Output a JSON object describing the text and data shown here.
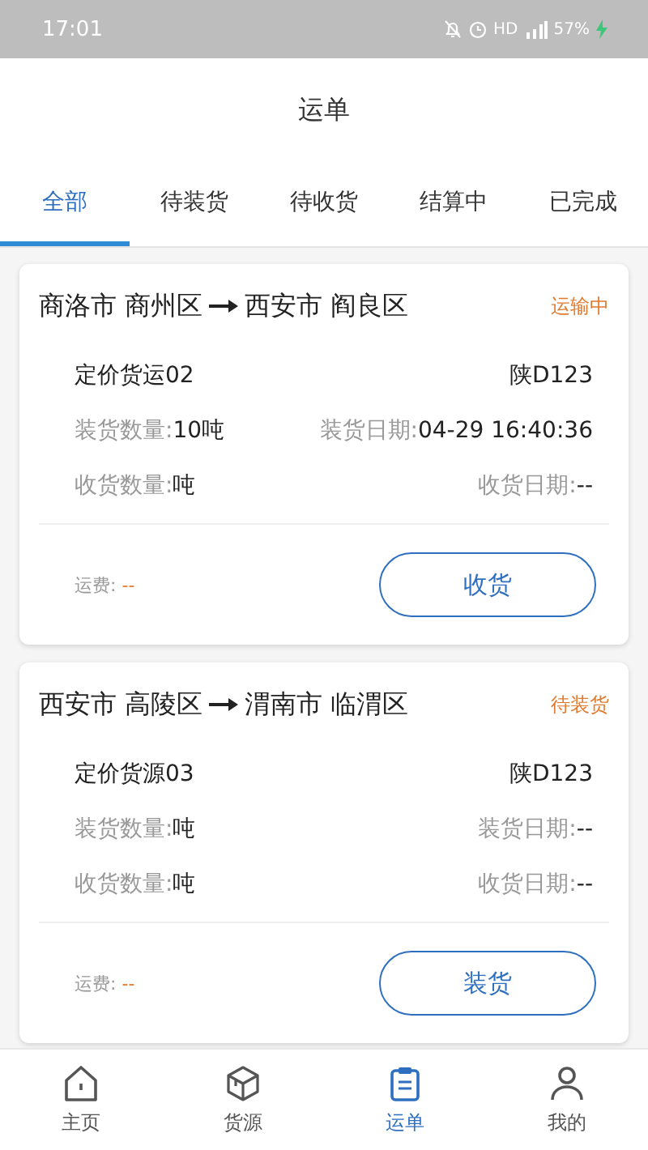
{
  "status_bar": {
    "time": "17:01",
    "network": "HD",
    "battery": "57%"
  },
  "title": "运单",
  "tabs": [
    {
      "label": "全部",
      "selected": true
    },
    {
      "label": "待装货",
      "selected": false
    },
    {
      "label": "待收货",
      "selected": false
    },
    {
      "label": "结算中",
      "selected": false
    },
    {
      "label": "已完成",
      "selected": false
    }
  ],
  "orders": [
    {
      "from": "商洛市 商州区",
      "to": "西安市 阎良区",
      "status": "运输中",
      "name": "定价货运02",
      "plate": "陕D123",
      "rows": [
        [
          {
            "label": "装货数量:",
            "value": "10吨"
          },
          {
            "label": "装货日期:",
            "value": "04-29 16:40:36"
          }
        ],
        [
          {
            "label": "收货数量:",
            "value": "吨"
          },
          {
            "label": "收货日期:",
            "value": "--"
          }
        ]
      ],
      "fee_label": "运费:",
      "fee_value": "--",
      "action": "收货"
    },
    {
      "from": "西安市 高陵区",
      "to": "渭南市 临渭区",
      "status": "待装货",
      "name": "定价货源03",
      "plate": "陕D123",
      "rows": [
        [
          {
            "label": "装货数量:",
            "value": "吨"
          },
          {
            "label": "装货日期:",
            "value": "--"
          }
        ],
        [
          {
            "label": "收货数量:",
            "value": "吨"
          },
          {
            "label": "收货日期:",
            "value": "--"
          }
        ]
      ],
      "fee_label": "运费:",
      "fee_value": "--",
      "action": "装货"
    }
  ],
  "nav": [
    {
      "label": "主页",
      "selected": false
    },
    {
      "label": "货源",
      "selected": false
    },
    {
      "label": "运单",
      "selected": true
    },
    {
      "label": "我的",
      "selected": false
    }
  ]
}
